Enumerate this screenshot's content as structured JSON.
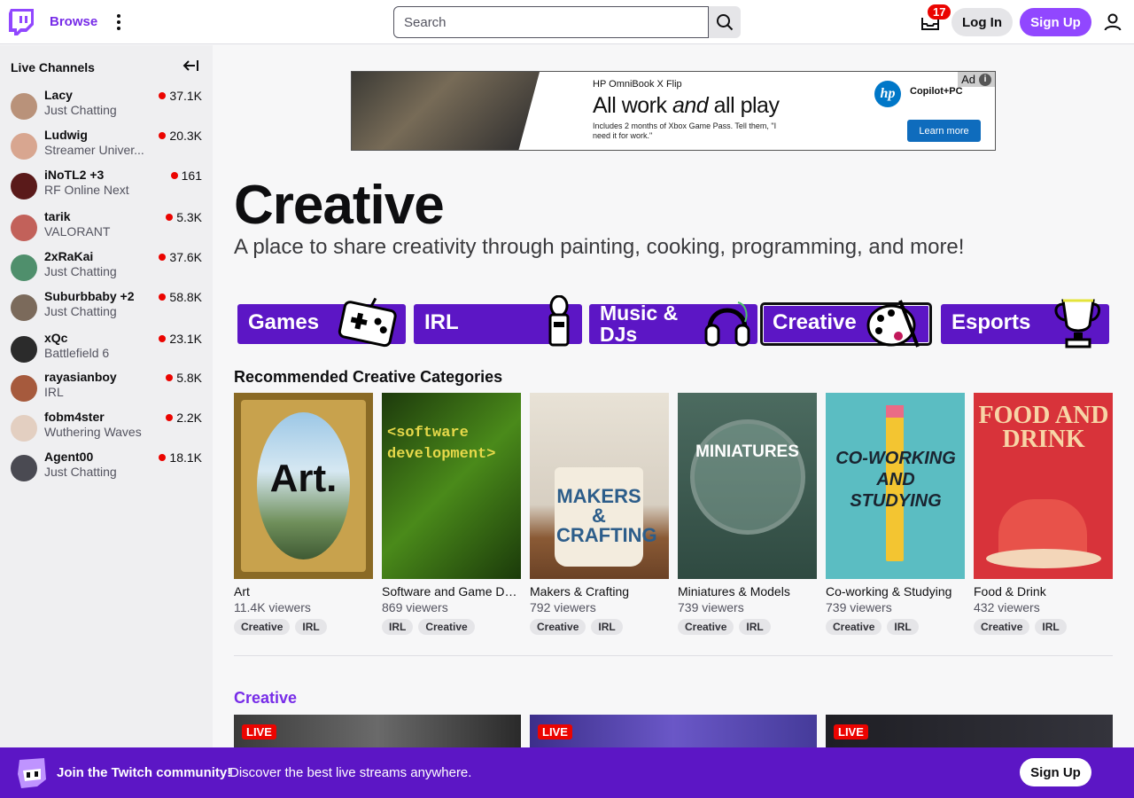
{
  "nav": {
    "browse": "Browse",
    "search_placeholder": "Search",
    "inbox_count": "17",
    "login": "Log In",
    "signup": "Sign Up"
  },
  "sidebar": {
    "title": "Live Channels",
    "channels": [
      {
        "name": "Lacy",
        "game": "Just Chatting",
        "viewers": "37.1K",
        "color": "#b9927a"
      },
      {
        "name": "Ludwig",
        "game": "Streamer Univer...",
        "viewers": "20.3K",
        "color": "#d8a690"
      },
      {
        "name": "iNoTL2 +3",
        "game": "RF Online Next",
        "viewers": "161",
        "color": "#5a1a1a"
      },
      {
        "name": "tarik",
        "game": "VALORANT",
        "viewers": "5.3K",
        "color": "#c2615a"
      },
      {
        "name": "2xRaKai",
        "game": "Just Chatting",
        "viewers": "37.6K",
        "color": "#4f8f6c"
      },
      {
        "name": "Suburbbaby +2",
        "game": "Just Chatting",
        "viewers": "58.8K",
        "color": "#7b6a5b"
      },
      {
        "name": "xQc",
        "game": "Battlefield 6",
        "viewers": "23.1K",
        "color": "#2b2b2b"
      },
      {
        "name": "rayasianboy",
        "game": "IRL",
        "viewers": "5.8K",
        "color": "#a65a3d"
      },
      {
        "name": "fobm4ster",
        "game": "Wuthering Waves",
        "viewers": "2.2K",
        "color": "#e3cfc1"
      },
      {
        "name": "Agent00",
        "game": "Just Chatting",
        "viewers": "18.1K",
        "color": "#4a4a52"
      }
    ]
  },
  "ad": {
    "subtitle": "HP OmniBook X Flip",
    "headline_a": "All work ",
    "headline_b": "and",
    "headline_c": " all play",
    "fine": "Includes 2 months of Xbox Game Pass. Tell them, \"I need it for work.\"",
    "brand": "hp",
    "partner": "Copilot+PC",
    "cta": "Learn more",
    "label": "Ad",
    "info": "i"
  },
  "page": {
    "title": "Creative",
    "subtitle": "A place to share creativity through painting, cooking, programming, and more!"
  },
  "categories": [
    {
      "label": "Games"
    },
    {
      "label": "IRL"
    },
    {
      "label": "Music & DJs"
    },
    {
      "label": "Creative"
    },
    {
      "label": "Esports"
    }
  ],
  "recommended": {
    "title": "Recommended Creative Categories",
    "cards": [
      {
        "name": "Art",
        "viewers": "11.4K viewers",
        "tags": [
          "Creative",
          "IRL"
        ],
        "art_text": "Art."
      },
      {
        "name": "Software and Game De...",
        "viewers": "869 viewers",
        "tags": [
          "IRL",
          "Creative"
        ],
        "art_text": "<software development>"
      },
      {
        "name": "Makers & Crafting",
        "viewers": "792 viewers",
        "tags": [
          "Creative",
          "IRL"
        ],
        "art_text": "MAKERS & CRAFTING"
      },
      {
        "name": "Miniatures & Models",
        "viewers": "739 viewers",
        "tags": [
          "Creative",
          "IRL"
        ],
        "art_text": "MINIATURES"
      },
      {
        "name": "Co-working & Studying",
        "viewers": "739 viewers",
        "tags": [
          "Creative",
          "IRL"
        ],
        "art_text": "CO-WORKING AND STUDYING"
      },
      {
        "name": "Food & Drink",
        "viewers": "432 viewers",
        "tags": [
          "Creative",
          "IRL"
        ],
        "art_text": "FOOD AND DRINK"
      }
    ]
  },
  "section": {
    "title": "Creative",
    "live_label": "LIVE"
  },
  "banner": {
    "title": "Join the Twitch community!",
    "subtitle": "Discover the best live streams anywhere.",
    "signup": "Sign Up"
  },
  "colors": {
    "brand": "#9147ff",
    "brand_dark": "#5c16c5",
    "live": "#eb0400"
  }
}
